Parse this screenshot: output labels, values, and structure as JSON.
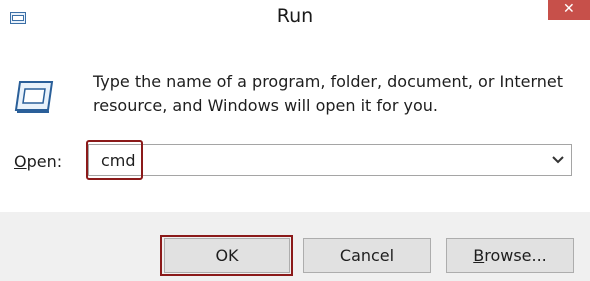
{
  "window": {
    "title": "Run",
    "close_glyph": "✕"
  },
  "description": "Type the name of a program, folder, document, or Internet resource, and Windows will open it for you.",
  "open_field": {
    "label_underlined": "O",
    "label_rest": "pen:",
    "value": "cmd"
  },
  "buttons": {
    "ok": "OK",
    "cancel": "Cancel",
    "browse_underlined": "B",
    "browse_rest": "rowse..."
  },
  "icons": {
    "title": "run-app-icon",
    "dialog": "run-dialog-icon",
    "dropdown": "chevron-down-icon",
    "close": "close-icon"
  },
  "colors": {
    "close_button": "#c7504a",
    "highlight": "#8b1a1a",
    "footer": "#f0f0f0"
  }
}
